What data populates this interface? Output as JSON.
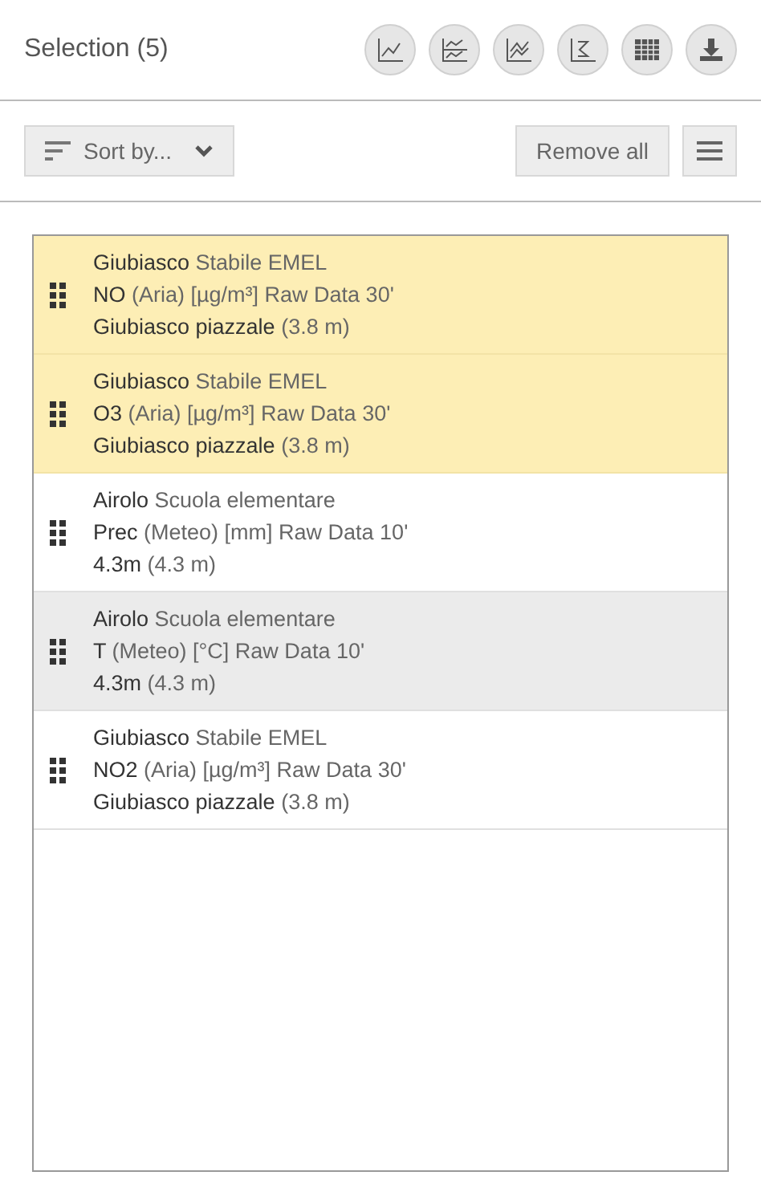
{
  "header": {
    "title": "Selection (5)",
    "tools": [
      {
        "kind": "line"
      },
      {
        "kind": "stacked"
      },
      {
        "kind": "multi"
      },
      {
        "kind": "profile"
      },
      {
        "kind": "table"
      },
      {
        "kind": "download"
      }
    ]
  },
  "toolbar": {
    "sort": "Sort by...",
    "remove_all": "Remove all"
  },
  "items": [
    {
      "lines": [
        "**Giubiasco** Stabile EMEL",
        "**NO** (Aria) [µg/m³] Raw Data 30'",
        "**Giubiasco piazzale** (3.8 m)"
      ],
      "selected": true,
      "hovered": false
    },
    {
      "lines": [
        "**Giubiasco** Stabile EMEL",
        "**O3** (Aria) [µg/m³] Raw Data 30'",
        "**Giubiasco piazzale** (3.8 m)"
      ],
      "selected": true,
      "hovered": false
    },
    {
      "lines": [
        "**Airolo** Scuola elementare",
        "**Prec** (Meteo) [mm] Raw Data 10'",
        "**4.3m** (4.3 m)"
      ],
      "selected": false,
      "hovered": false
    },
    {
      "lines": [
        "**Airolo** Scuola elementare",
        "**T** (Meteo) [°C] Raw Data 10'",
        "**4.3m** (4.3 m)"
      ],
      "selected": false,
      "hovered": true
    },
    {
      "lines": [
        "**Giubiasco** Stabile EMEL",
        "**NO2** (Aria) [µg/m³] Raw Data 30'",
        "**Giubiasco piazzale** (3.8 m)"
      ],
      "selected": false,
      "hovered": false
    }
  ]
}
